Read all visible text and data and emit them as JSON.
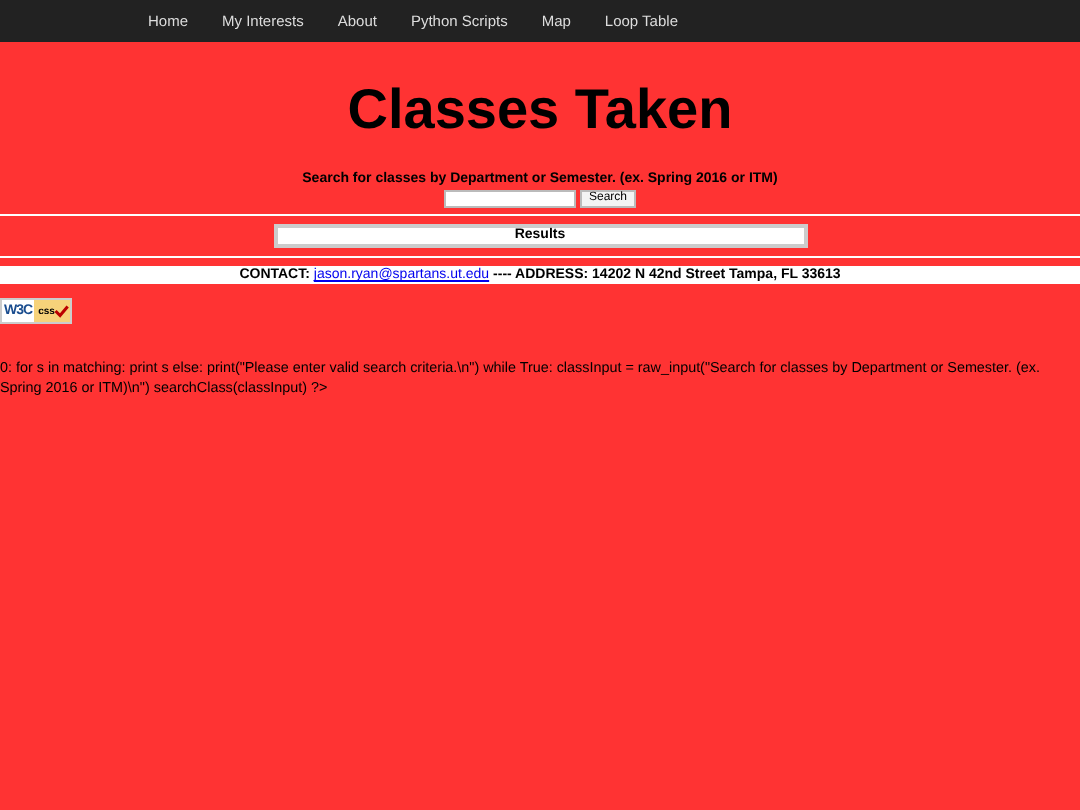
{
  "nav": {
    "links": [
      "Home",
      "My Interests",
      "About",
      "Python Scripts",
      "Map",
      "Loop Table"
    ]
  },
  "title": "Classes Taken",
  "search": {
    "prompt": "Search for classes by Department or Semester. (ex. Spring 2016 or ITM)",
    "button": "Search"
  },
  "results": {
    "heading": "Results"
  },
  "contact": {
    "label": "CONTACT:",
    "email": "jason.ryan@spartans.ut.edu",
    "address": "---- ADDRESS: 14202 N 42nd Street Tampa, FL 33613"
  },
  "badge": {
    "left": "W3C",
    "right": "css"
  },
  "code_text": "0: for s in matching: print s else: print(\"Please enter valid search criteria.\\n\") while True: classInput = raw_input(\"Search for classes by Department or Semester. (ex. Spring 2016 or ITM)\\n\") searchClass(classInput) ?>"
}
